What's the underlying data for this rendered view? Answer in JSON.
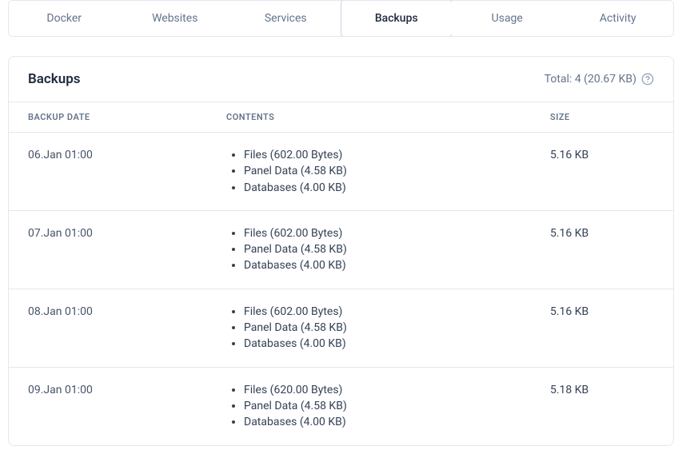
{
  "tabs": [
    {
      "label": "Docker",
      "active": false
    },
    {
      "label": "Websites",
      "active": false
    },
    {
      "label": "Services",
      "active": false
    },
    {
      "label": "Backups",
      "active": true
    },
    {
      "label": "Usage",
      "active": false
    },
    {
      "label": "Activity",
      "active": false
    }
  ],
  "panel": {
    "title": "Backups",
    "total": "Total: 4 (20.67 KB)"
  },
  "columns": {
    "date": "BACKUP DATE",
    "contents": "CONTENTS",
    "size": "SIZE"
  },
  "rows": [
    {
      "date": "06.Jan 01:00",
      "contents": [
        "Files (602.00 Bytes)",
        "Panel Data (4.58 KB)",
        "Databases (4.00 KB)"
      ],
      "size": "5.16 KB"
    },
    {
      "date": "07.Jan 01:00",
      "contents": [
        "Files (602.00 Bytes)",
        "Panel Data (4.58 KB)",
        "Databases (4.00 KB)"
      ],
      "size": "5.16 KB"
    },
    {
      "date": "08.Jan 01:00",
      "contents": [
        "Files (602.00 Bytes)",
        "Panel Data (4.58 KB)",
        "Databases (4.00 KB)"
      ],
      "size": "5.16 KB"
    },
    {
      "date": "09.Jan 01:00",
      "contents": [
        "Files (620.00 Bytes)",
        "Panel Data (4.58 KB)",
        "Databases (4.00 KB)"
      ],
      "size": "5.18 KB"
    }
  ]
}
